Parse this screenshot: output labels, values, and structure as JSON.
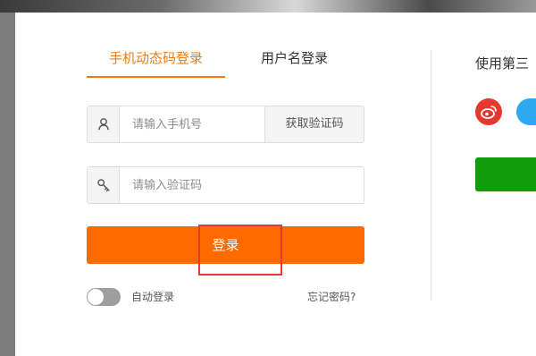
{
  "tabs": {
    "sms_login": "手机动态码登录",
    "username_login": "用户名登录"
  },
  "phone": {
    "placeholder": "请输入手机号",
    "get_code_label": "获取验证码",
    "icon": "user-icon"
  },
  "code": {
    "placeholder": "请输入验证码",
    "icon": "key-icon"
  },
  "login_button": "登录",
  "auto_login": {
    "label": "自动登录",
    "enabled": false
  },
  "forgot_password": "忘记密码?",
  "third_party": {
    "title": "使用第三",
    "icons": [
      "weibo-icon",
      "qq-icon"
    ]
  },
  "colors": {
    "accent": "#f07c15",
    "login_button": "#ff6a00",
    "highlight_box": "#e53935",
    "weibo": "#e6382e",
    "qq": "#2ea8f0",
    "green_button": "#119c0c"
  }
}
